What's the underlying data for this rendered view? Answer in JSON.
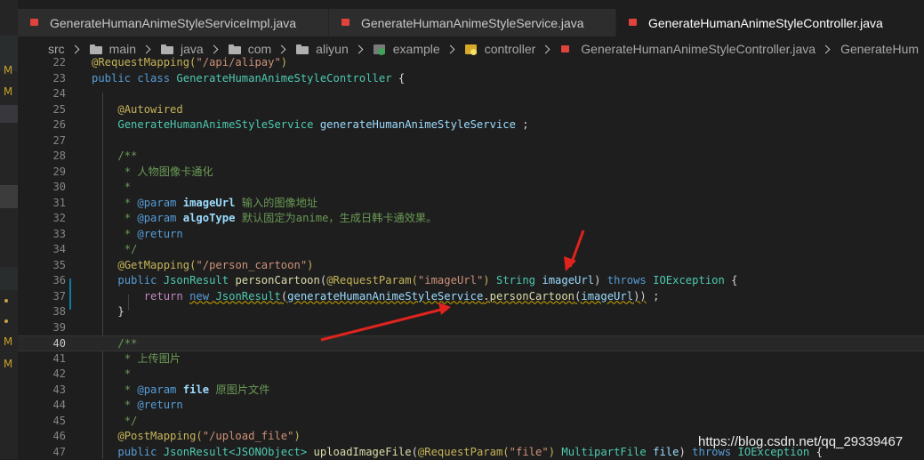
{
  "window": {
    "tabs": [
      {
        "label": "GenerateHumanAnimeStyleServiceImpl.java",
        "icon": "java-file-icon",
        "active": false
      },
      {
        "label": "GenerateHumanAnimeStyleService.java",
        "icon": "java-file-icon",
        "active": false
      },
      {
        "label": "GenerateHumanAnimeStyleController.java",
        "icon": "java-file-icon",
        "active": true
      }
    ]
  },
  "sidebar": {
    "markers": [
      "M",
      "M",
      "M",
      "M"
    ]
  },
  "breadcrumb": {
    "items": [
      "src",
      "main",
      "java",
      "com",
      "aliyun",
      "example",
      "controller",
      "GenerateHumanAnimeStyleController.java",
      "GenerateHum"
    ]
  },
  "editor": {
    "current_line": 40,
    "lines": [
      {
        "n": "22",
        "tokens": [
          [
            "ann",
            "@RequestMapping("
          ],
          [
            "str",
            "\"/api/alipay\""
          ],
          [
            "ann",
            ")"
          ]
        ]
      },
      {
        "n": "23",
        "tokens": [
          [
            "kw",
            "public"
          ],
          [
            "",
            " "
          ],
          [
            "kw",
            "class"
          ],
          [
            "",
            " "
          ],
          [
            "cls",
            "GenerateHumanAnimeStyleController"
          ],
          [
            "",
            " {"
          ]
        ]
      },
      {
        "n": "24",
        "tokens": []
      },
      {
        "n": "25",
        "tokens": [
          [
            "",
            "    "
          ],
          [
            "ann",
            "@Autowired"
          ]
        ]
      },
      {
        "n": "26",
        "tokens": [
          [
            "",
            "    "
          ],
          [
            "cls",
            "GenerateHumanAnimeStyleService"
          ],
          [
            "",
            " "
          ],
          [
            "var",
            "generateHumanAnimeStyleService"
          ],
          [
            "",
            " ;"
          ]
        ]
      },
      {
        "n": "27",
        "tokens": []
      },
      {
        "n": "28",
        "tokens": [
          [
            "",
            "    "
          ],
          [
            "cmt",
            "/**"
          ]
        ]
      },
      {
        "n": "29",
        "tokens": [
          [
            "",
            "    "
          ],
          [
            "cmt",
            " * 人物图像卡通化"
          ]
        ]
      },
      {
        "n": "30",
        "tokens": [
          [
            "",
            "    "
          ],
          [
            "cmt",
            " *"
          ]
        ]
      },
      {
        "n": "31",
        "tokens": [
          [
            "",
            "    "
          ],
          [
            "cmt",
            " * "
          ],
          [
            "doctag",
            "@param"
          ],
          [
            "",
            " "
          ],
          [
            "var bold",
            "imageUrl"
          ],
          [
            "cmt",
            " 输入的图像地址"
          ]
        ]
      },
      {
        "n": "32",
        "tokens": [
          [
            "",
            "    "
          ],
          [
            "cmt",
            " * "
          ],
          [
            "doctag",
            "@param"
          ],
          [
            "",
            " "
          ],
          [
            "var bold",
            "algoType"
          ],
          [
            "cmt",
            " 默认固定为anime，生成日韩卡通效果。"
          ]
        ]
      },
      {
        "n": "33",
        "tokens": [
          [
            "",
            "    "
          ],
          [
            "cmt",
            " * "
          ],
          [
            "doctag",
            "@return"
          ]
        ]
      },
      {
        "n": "34",
        "tokens": [
          [
            "",
            "    "
          ],
          [
            "cmt",
            " */"
          ]
        ]
      },
      {
        "n": "35",
        "tokens": [
          [
            "",
            "    "
          ],
          [
            "ann",
            "@GetMapping("
          ],
          [
            "str",
            "\"/person_cartoon\""
          ],
          [
            "ann",
            ")"
          ]
        ]
      },
      {
        "n": "36",
        "tokens": [
          [
            "",
            "    "
          ],
          [
            "kw",
            "public"
          ],
          [
            "",
            " "
          ],
          [
            "cls",
            "JsonResult"
          ],
          [
            "",
            " "
          ],
          [
            "fn",
            "personCartoon"
          ],
          [
            "",
            "("
          ],
          [
            "ann",
            "@RequestParam("
          ],
          [
            "str",
            "\"imageUrl\""
          ],
          [
            "ann",
            ")"
          ],
          [
            "",
            " "
          ],
          [
            "cls",
            "String"
          ],
          [
            "",
            " "
          ],
          [
            "var",
            "imageUrl"
          ],
          [
            "",
            ") "
          ],
          [
            "kw",
            "throws"
          ],
          [
            "",
            " "
          ],
          [
            "cls",
            "IOException"
          ],
          [
            "",
            " {"
          ]
        ]
      },
      {
        "n": "37",
        "tokens": [
          [
            "",
            "        "
          ],
          [
            "ctl",
            "return"
          ],
          [
            "",
            " "
          ],
          [
            "kw squig",
            "new"
          ],
          [
            "squig",
            " "
          ],
          [
            "cls squig",
            "JsonResult"
          ],
          [
            "squig",
            "("
          ],
          [
            "var squig",
            "generateHumanAnimeStyleService"
          ],
          [
            "squig",
            "."
          ],
          [
            "fn squig",
            "personCartoon"
          ],
          [
            "squig",
            "("
          ],
          [
            "var squig",
            "imageUrl"
          ],
          [
            "squig",
            "))"
          ],
          [
            "",
            " ;"
          ]
        ]
      },
      {
        "n": "38",
        "tokens": [
          [
            "",
            "    }"
          ]
        ]
      },
      {
        "n": "39",
        "tokens": []
      },
      {
        "n": "40",
        "tokens": [
          [
            "",
            "    "
          ],
          [
            "cmt",
            "/**"
          ]
        ]
      },
      {
        "n": "41",
        "tokens": [
          [
            "",
            "    "
          ],
          [
            "cmt",
            " * 上传图片"
          ]
        ]
      },
      {
        "n": "42",
        "tokens": [
          [
            "",
            "    "
          ],
          [
            "cmt",
            " *"
          ]
        ]
      },
      {
        "n": "43",
        "tokens": [
          [
            "",
            "    "
          ],
          [
            "cmt",
            " * "
          ],
          [
            "doctag",
            "@param"
          ],
          [
            "",
            " "
          ],
          [
            "var bold",
            "file"
          ],
          [
            "cmt",
            " 原图片文件"
          ]
        ]
      },
      {
        "n": "44",
        "tokens": [
          [
            "",
            "    "
          ],
          [
            "cmt",
            " * "
          ],
          [
            "doctag",
            "@return"
          ]
        ]
      },
      {
        "n": "45",
        "tokens": [
          [
            "",
            "    "
          ],
          [
            "cmt",
            " */"
          ]
        ]
      },
      {
        "n": "46",
        "tokens": [
          [
            "",
            "    "
          ],
          [
            "ann",
            "@PostMapping("
          ],
          [
            "str",
            "\"/upload_file\""
          ],
          [
            "ann",
            ")"
          ]
        ]
      },
      {
        "n": "47",
        "tokens": [
          [
            "",
            "    "
          ],
          [
            "kw",
            "public"
          ],
          [
            "",
            " "
          ],
          [
            "cls",
            "JsonResult<JSONObject>"
          ],
          [
            "",
            " "
          ],
          [
            "fn",
            "uploadImageFile"
          ],
          [
            "",
            "("
          ],
          [
            "ann",
            "@RequestParam("
          ],
          [
            "str",
            "\"file\""
          ],
          [
            "ann",
            ")"
          ],
          [
            "",
            " "
          ],
          [
            "cls",
            "MultipartFile"
          ],
          [
            "",
            " "
          ],
          [
            "var",
            "file"
          ],
          [
            "",
            ") "
          ],
          [
            "kw",
            "throws"
          ],
          [
            "",
            " "
          ],
          [
            "cls",
            "IOException"
          ],
          [
            "",
            " {"
          ]
        ]
      }
    ]
  },
  "watermark": {
    "text": "https://blog.csdn.net/qq_29339467"
  },
  "colors": {
    "arrow": "#e0231d",
    "accent": "#0c7d9d"
  }
}
